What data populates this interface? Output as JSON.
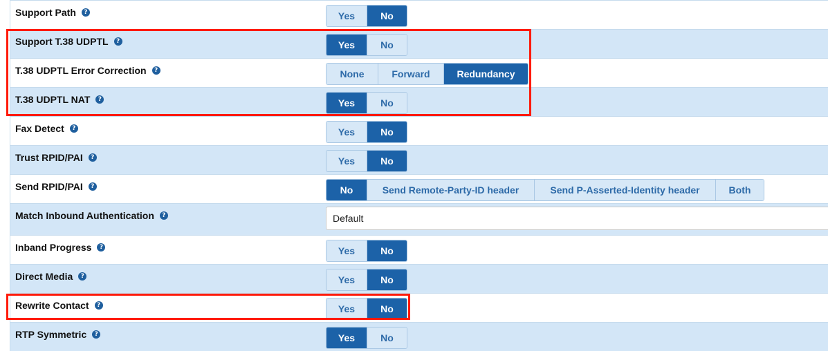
{
  "help_glyph": "?",
  "yes_label": "Yes",
  "no_label": "No",
  "rows": [
    {
      "label": "Support Path",
      "selected": "No"
    },
    {
      "label": "Support T.38 UDPTL",
      "selected": "Yes"
    },
    {
      "label": "T.38 UDPTL Error Correction",
      "options": [
        "None",
        "Forward",
        "Redundancy"
      ],
      "selected": "Redundancy"
    },
    {
      "label": "T.38 UDPTL NAT",
      "selected": "Yes"
    },
    {
      "label": "Fax Detect",
      "selected": "No"
    },
    {
      "label": "Trust RPID/PAI",
      "selected": "No"
    },
    {
      "label": "Send RPID/PAI",
      "options": [
        "No",
        "Send Remote-Party-ID header",
        "Send P-Asserted-Identity header",
        "Both"
      ],
      "selected": "No"
    },
    {
      "label": "Match Inbound Authentication",
      "select_value": "Default"
    },
    {
      "label": "Inband Progress",
      "selected": "No"
    },
    {
      "label": "Direct Media",
      "selected": "No"
    },
    {
      "label": "Rewrite Contact",
      "selected": "No"
    },
    {
      "label": "RTP Symmetric",
      "selected": "Yes"
    }
  ],
  "colors": {
    "active_button": "#1c62a8",
    "inactive_button": "#d7e8f7",
    "row_shaded": "#d3e6f7",
    "highlight": "#ff1a0a"
  }
}
